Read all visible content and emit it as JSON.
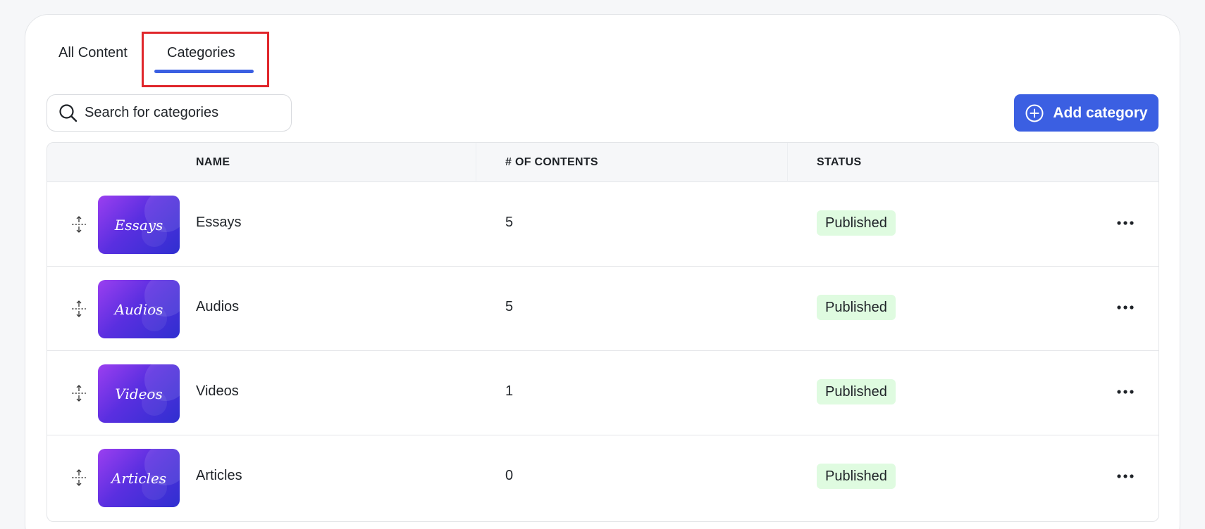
{
  "tabs": [
    {
      "label": "All Content"
    },
    {
      "label": "Categories"
    }
  ],
  "search": {
    "placeholder": "Search for categories",
    "icon": "search-icon"
  },
  "add_button": {
    "label": "Add category",
    "icon": "plus-circle-icon"
  },
  "colors": {
    "accent": "#3b5fe2",
    "highlight": "#e0262b",
    "badge_bg": "#dffbe0"
  },
  "table": {
    "headers": {
      "name": "NAME",
      "count": "# OF CONTENTS",
      "status": "STATUS"
    },
    "rows": [
      {
        "thumb": "Essays",
        "name": "Essays",
        "count": "5",
        "status": "Published"
      },
      {
        "thumb": "Audios",
        "name": "Audios",
        "count": "5",
        "status": "Published"
      },
      {
        "thumb": "Videos",
        "name": "Videos",
        "count": "1",
        "status": "Published"
      },
      {
        "thumb": "Articles",
        "name": "Articles",
        "count": "0",
        "status": "Published"
      }
    ]
  }
}
